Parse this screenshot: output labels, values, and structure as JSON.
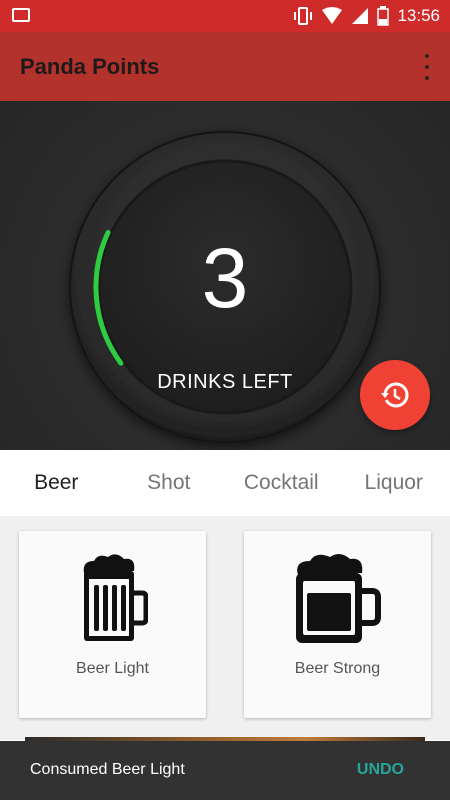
{
  "status_bar": {
    "time": "13:56"
  },
  "app_bar": {
    "title": "Panda Points"
  },
  "counter": {
    "value": "3",
    "label": "DRINKS LEFT",
    "progress_fraction": 0.17
  },
  "tabs": [
    {
      "label": "Beer",
      "active": true
    },
    {
      "label": "Shot",
      "active": false
    },
    {
      "label": "Cocktail",
      "active": false
    },
    {
      "label": "Liquor",
      "active": false
    }
  ],
  "drinks": [
    {
      "label": "Beer Light",
      "icon": "beer-light-icon"
    },
    {
      "label": "Beer Strong",
      "icon": "beer-strong-icon"
    }
  ],
  "snackbar": {
    "message": "Consumed Beer Light",
    "action": "UNDO"
  },
  "colors": {
    "status_bar": "#cf2b2b",
    "app_bar": "#b3322b",
    "fab": "#ef4234",
    "progress": "#2ecc40",
    "undo": "#26a69a"
  }
}
